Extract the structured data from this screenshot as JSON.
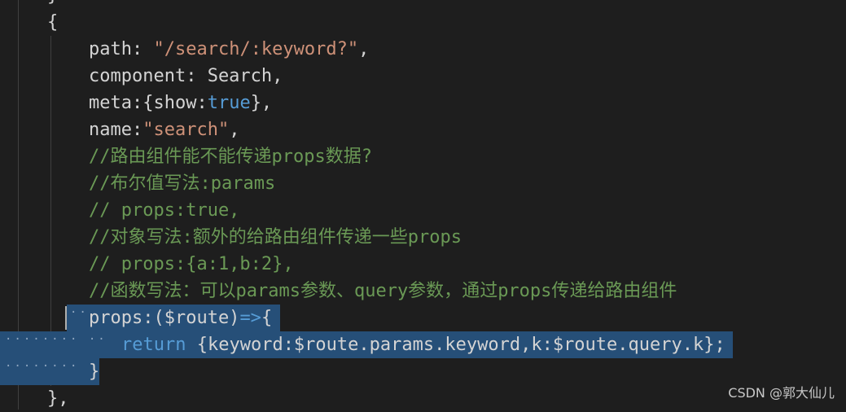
{
  "code": {
    "top_fragment": "}",
    "open_brace": "{",
    "path_key": "path: ",
    "path_val": "\"/search/:keyword?\"",
    "path_end": ",",
    "component_line": "component: Search,",
    "meta_key": "meta:{show:",
    "meta_val": "true",
    "meta_end": "},",
    "name_key": "name:",
    "name_val": "\"search\"",
    "name_end": ",",
    "comment1": "//路由组件能不能传递props数据?",
    "comment2": "//布尔值写法:params",
    "comment3": "// props:true,",
    "comment4": "//对象写法:额外的给路由组件传递一些props",
    "comment5": "// props:{a:1,b:2},",
    "comment6": "//函数写法：可以params参数、query参数，通过props传递给路由组件",
    "props_head": "props:($route)",
    "arrow": "=>",
    "props_open": "{",
    "return_kw": "return",
    "return_body": " {keyword:$route.params.keyword,k:$route.query.k};",
    "props_close": "}",
    "closing": "},"
  },
  "watermark": "CSDN @郭大仙儿",
  "colors": {
    "background": "#1e1e1e",
    "selection": "#264f78",
    "string": "#ce9178",
    "keyword": "#569cd6",
    "comment": "#6a9955"
  }
}
